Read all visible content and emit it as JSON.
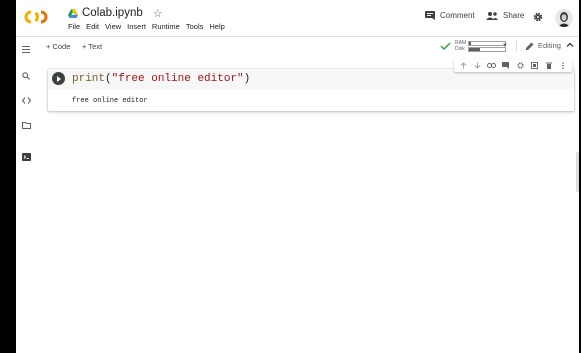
{
  "header": {
    "title": "Colab.ipynb",
    "menu": [
      "File",
      "Edit",
      "View",
      "Insert",
      "Runtime",
      "Tools",
      "Help"
    ],
    "comment_label": "Comment",
    "share_label": "Share"
  },
  "toolbar": {
    "add_code": "+ Code",
    "add_text": "+ Text",
    "ram_label": "RAM",
    "disk_label": "Disk",
    "ram_usage": 0.05,
    "disk_usage": 0.3,
    "mode_label": "Editing"
  },
  "cell": {
    "code_fn": "print",
    "code_open": "(",
    "code_string": "\"free online editor\"",
    "code_close": ")",
    "output": "free online editor"
  },
  "colors": {
    "logo_orange": "#f9ab00",
    "accent_check": "#34a853",
    "string_red": "#a31515"
  }
}
